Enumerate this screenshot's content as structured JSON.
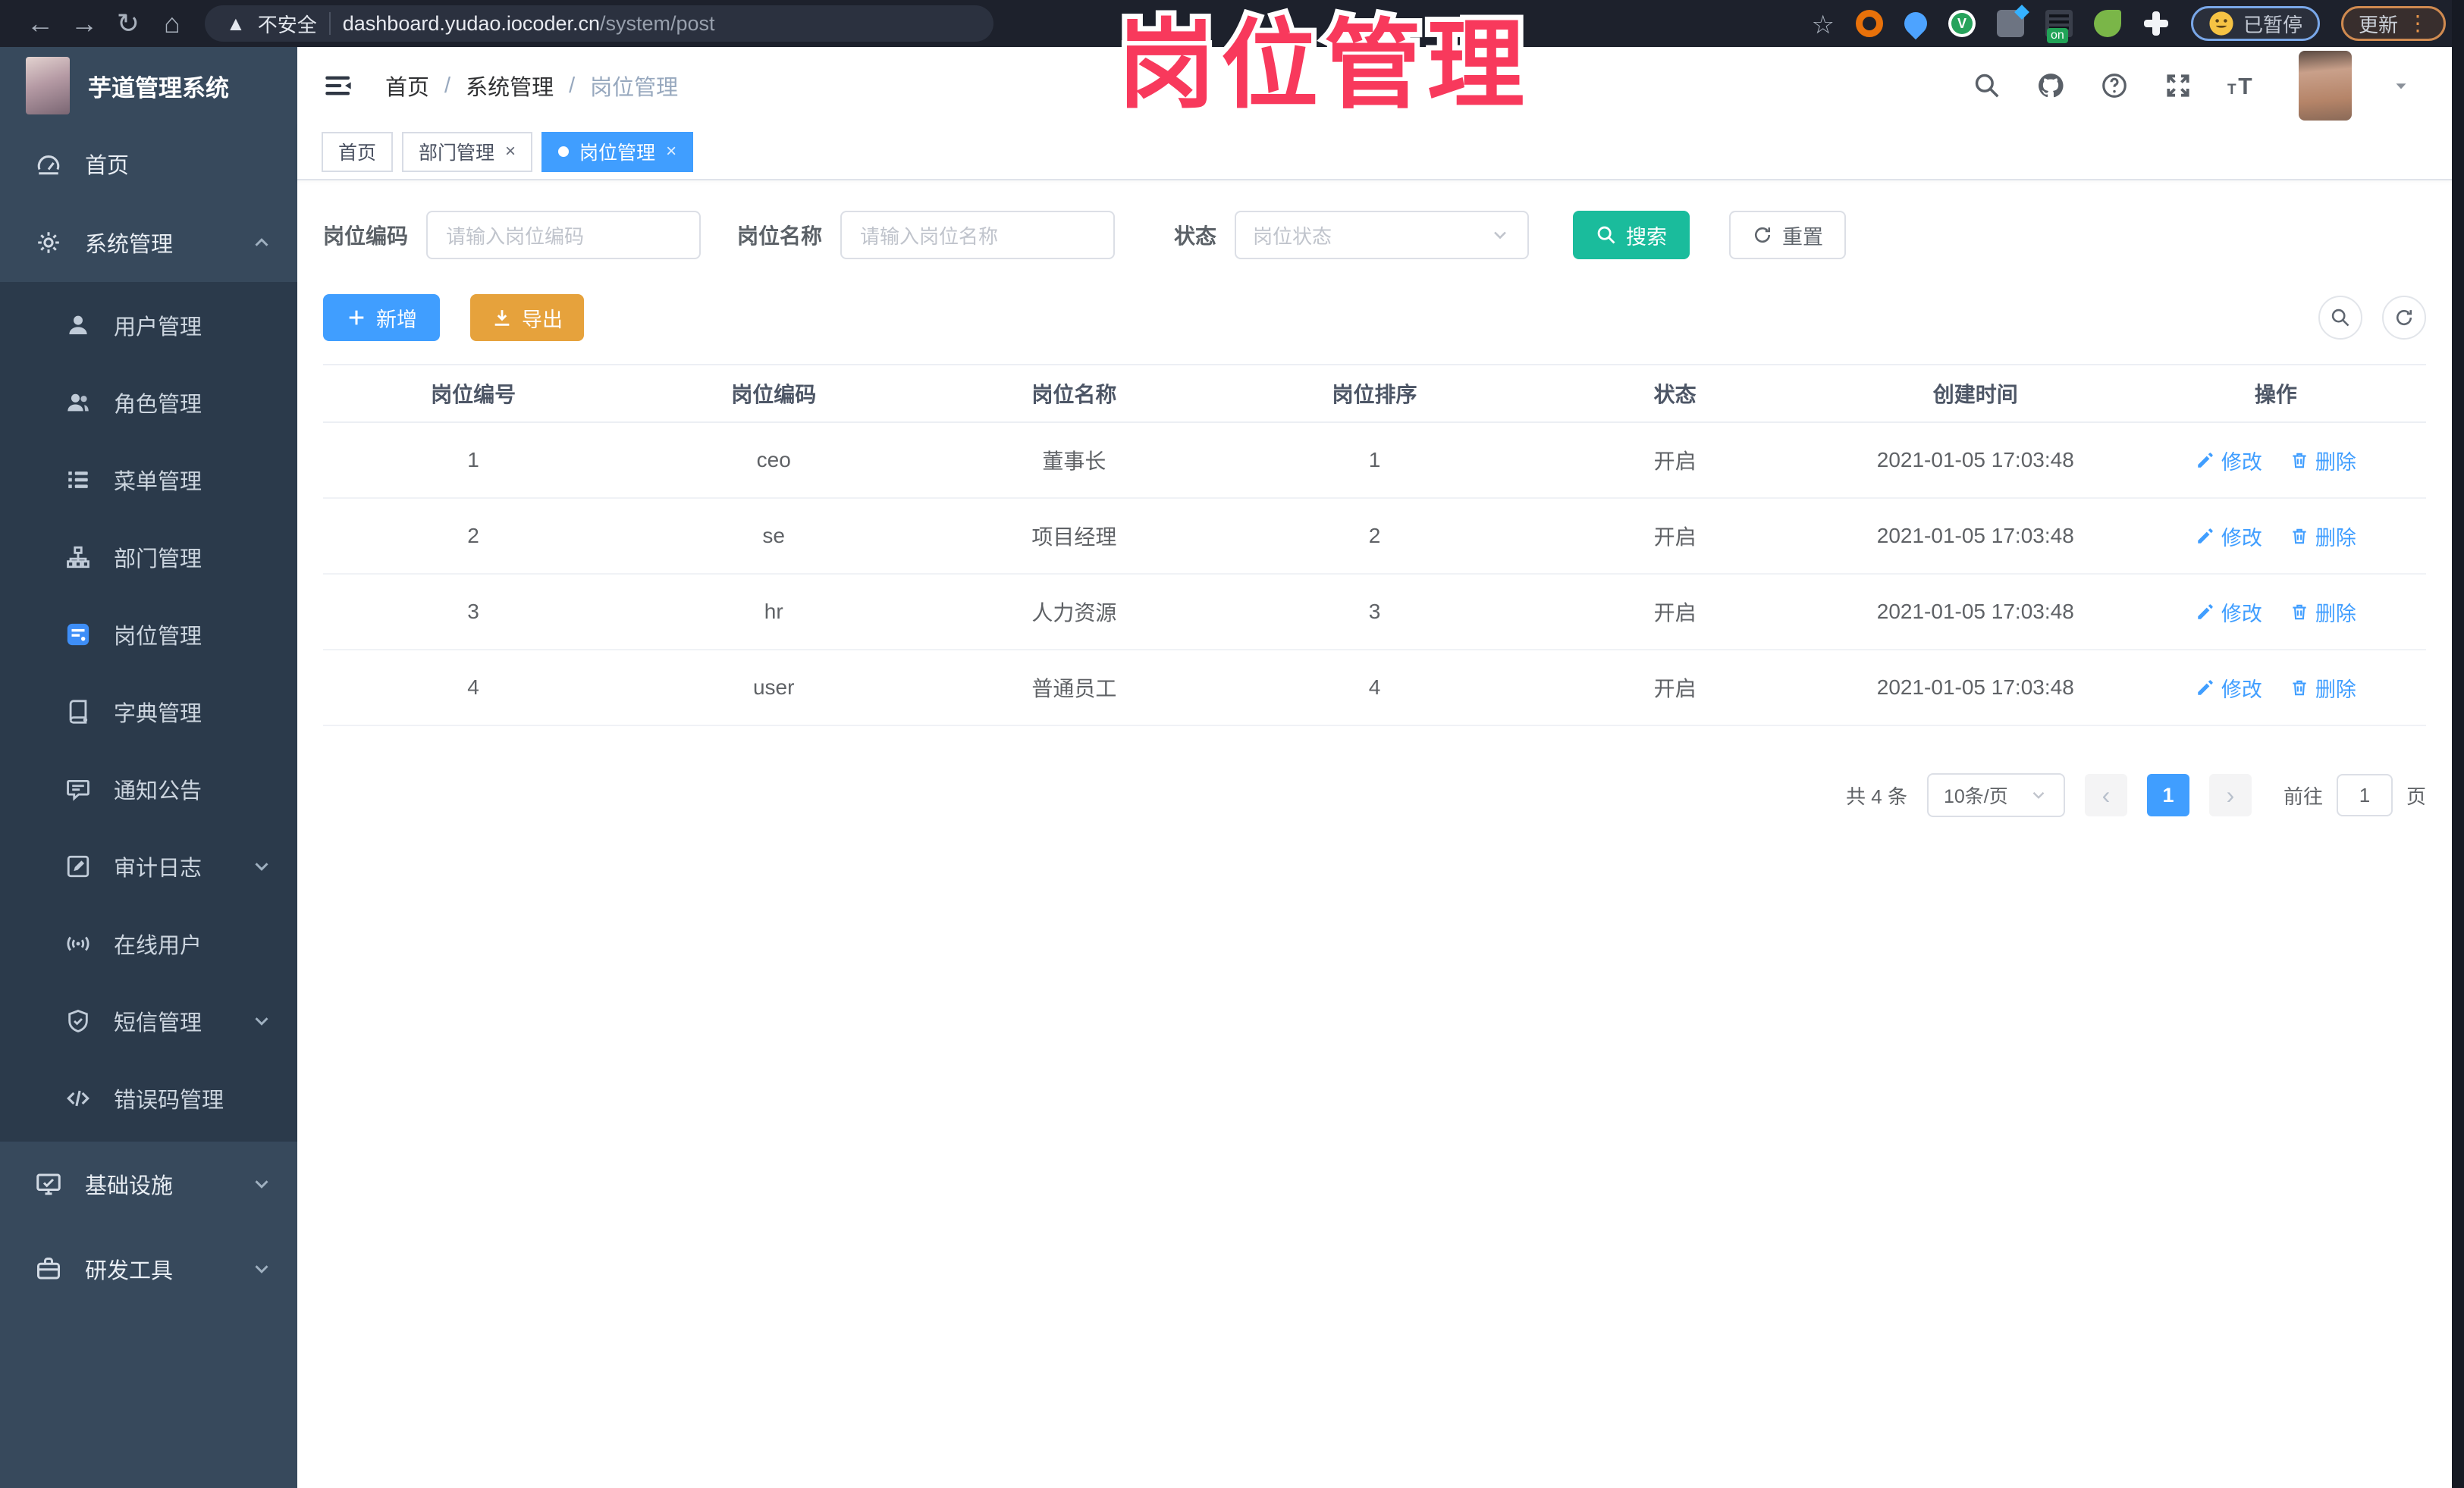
{
  "browser": {
    "security_label": "不安全",
    "url_host": "dashboard.yudao.iocoder.cn",
    "url_path": "/system/post",
    "extension_badge": "on",
    "paused_label": "已暂停",
    "update_label": "更新"
  },
  "overlay_title": "岗位管理",
  "sidebar": {
    "app_title": "芋道管理系统",
    "items": [
      {
        "label": "首页",
        "icon": "dashboard-icon",
        "level": 1
      },
      {
        "label": "系统管理",
        "icon": "gear-icon",
        "level": 1,
        "chevron": "up"
      },
      {
        "label": "用户管理",
        "icon": "user-icon",
        "level": 2
      },
      {
        "label": "角色管理",
        "icon": "roles-icon",
        "level": 2
      },
      {
        "label": "菜单管理",
        "icon": "menu-list-icon",
        "level": 2
      },
      {
        "label": "部门管理",
        "icon": "org-tree-icon",
        "level": 2
      },
      {
        "label": "岗位管理",
        "icon": "post-badge-icon",
        "level": 2,
        "active": true
      },
      {
        "label": "字典管理",
        "icon": "dict-book-icon",
        "level": 2
      },
      {
        "label": "通知公告",
        "icon": "announcement-icon",
        "level": 2
      },
      {
        "label": "审计日志",
        "icon": "audit-log-icon",
        "level": 2,
        "chevron": "down"
      },
      {
        "label": "在线用户",
        "icon": "online-users-icon",
        "level": 2
      },
      {
        "label": "短信管理",
        "icon": "sms-shield-icon",
        "level": 2,
        "chevron": "down"
      },
      {
        "label": "错误码管理",
        "icon": "error-code-icon",
        "level": 2
      },
      {
        "label": "基础设施",
        "icon": "infrastructure-icon",
        "level": 1,
        "chevron": "down",
        "bottom": true
      },
      {
        "label": "研发工具",
        "icon": "devtools-icon",
        "level": 1,
        "chevron": "down",
        "bottom": true
      }
    ]
  },
  "header": {
    "breadcrumb": [
      "首页",
      "系统管理",
      "岗位管理"
    ]
  },
  "tabs": [
    {
      "label": "首页",
      "closable": false,
      "active": false
    },
    {
      "label": "部门管理",
      "closable": true,
      "active": false
    },
    {
      "label": "岗位管理",
      "closable": true,
      "active": true
    }
  ],
  "filter": {
    "code_label": "岗位编码",
    "code_placeholder": "请输入岗位编码",
    "name_label": "岗位名称",
    "name_placeholder": "请输入岗位名称",
    "status_label": "状态",
    "status_placeholder": "岗位状态",
    "search_label": "搜索",
    "reset_label": "重置"
  },
  "toolbar": {
    "add_label": "新增",
    "export_label": "导出"
  },
  "table": {
    "headers": [
      "岗位编号",
      "岗位编码",
      "岗位名称",
      "岗位排序",
      "状态",
      "创建时间",
      "操作"
    ],
    "rows": [
      {
        "id": "1",
        "code": "ceo",
        "name": "董事长",
        "sort": "1",
        "status": "开启",
        "created": "2021-01-05 17:03:48"
      },
      {
        "id": "2",
        "code": "se",
        "name": "项目经理",
        "sort": "2",
        "status": "开启",
        "created": "2021-01-05 17:03:48"
      },
      {
        "id": "3",
        "code": "hr",
        "name": "人力资源",
        "sort": "3",
        "status": "开启",
        "created": "2021-01-05 17:03:48"
      },
      {
        "id": "4",
        "code": "user",
        "name": "普通员工",
        "sort": "4",
        "status": "开启",
        "created": "2021-01-05 17:03:48"
      }
    ],
    "actions": {
      "edit": "修改",
      "delete": "删除"
    }
  },
  "pagination": {
    "total": "共 4 条",
    "page_size": "10条/页",
    "current_page": "1",
    "goto_label": "前往",
    "goto_value": "1",
    "unit_label": "页"
  },
  "colors": {
    "accent": "#409EFF",
    "search_teal": "#1ABC9C",
    "warning": "#E6A23C",
    "overlay_pink": "#F8395C"
  }
}
